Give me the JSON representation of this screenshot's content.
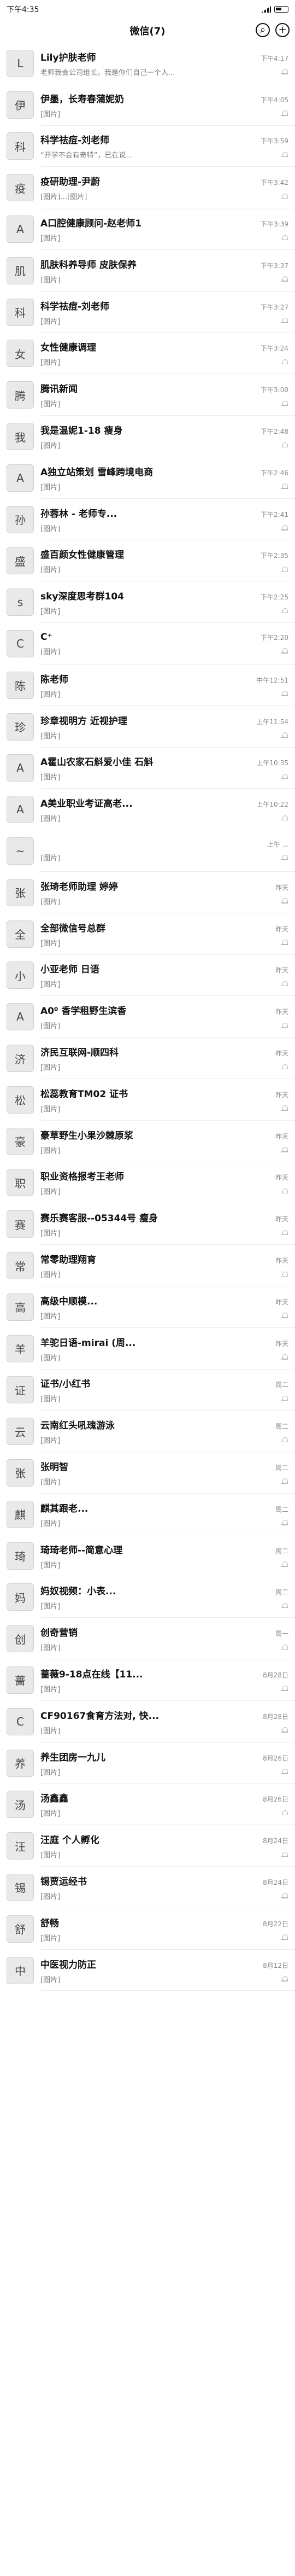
{
  "status": {
    "time": "下午4:35",
    "icon_name": "alarm-icon"
  },
  "header": {
    "title": "微信(7)"
  },
  "chats": [
    {
      "name": "Lily护肤老师",
      "time": "下午4:17",
      "preview": "老师我会公司组长，我是你们自己一个人...",
      "avatar": "L"
    },
    {
      "name": "伊墨，长寿春蒲妮奶",
      "time": "下午4:05",
      "preview": "[图片]",
      "avatar": "伊"
    },
    {
      "name": "科学祛痘-刘老师",
      "time": "下午3:59",
      "preview": "“开学不会有奇特”，已在说…",
      "avatar": "科"
    },
    {
      "name": "疫研助理-尹蔚",
      "time": "下午3:42",
      "preview": "[图片]…[图片]",
      "avatar": "疫"
    },
    {
      "name": "A口腔健康顾问-赵老师1",
      "time": "下午3:39",
      "preview": "[图片]",
      "avatar": "A"
    },
    {
      "name": "肌肤科养导师 皮肤保养",
      "time": "下午3:37",
      "preview": "[图片]",
      "avatar": "肌"
    },
    {
      "name": "科学祛痘-刘老师",
      "time": "下午3:27",
      "preview": "[图片]",
      "avatar": "科"
    },
    {
      "name": "女性健康调理",
      "time": "下午3:24",
      "preview": "[图片]",
      "avatar": "女"
    },
    {
      "name": "腾讯新闻",
      "time": "下午3:00",
      "preview": "[图片]",
      "avatar": "腾"
    },
    {
      "name": "我是温妮1-18 瘦身",
      "time": "下午2:48",
      "preview": "[图片]",
      "avatar": "我"
    },
    {
      "name": "A独立站策划 雪峰跨境电商",
      "time": "下午2:46",
      "preview": "[图片]",
      "avatar": "A"
    },
    {
      "name": "孙蓉林 - 老师专...",
      "time": "下午2:41",
      "preview": "[图片]",
      "avatar": "孙"
    },
    {
      "name": "盛百颜女性健康管理",
      "time": "下午2:35",
      "preview": "[图片]",
      "avatar": "盛"
    },
    {
      "name": "sky深度思考群104",
      "time": "下午2:25",
      "preview": "[图片]",
      "avatar": "s"
    },
    {
      "name": "C⁺",
      "time": "下午2:20",
      "preview": "[图片]",
      "avatar": "C"
    },
    {
      "name": "陈老师",
      "time": "中午12:51",
      "preview": "[图片]",
      "avatar": "陈"
    },
    {
      "name": "珍章视明方 近视护理",
      "time": "上午11:54",
      "preview": "[图片]",
      "avatar": "珍"
    },
    {
      "name": "A霍山农家石斛爱小佳 石斛",
      "time": "上午10:35",
      "preview": "[图片]",
      "avatar": "A"
    },
    {
      "name": "A美业职业考证高老...",
      "time": "上午10:22",
      "preview": "[图片]",
      "avatar": "A"
    },
    {
      "name": "",
      "time": "上午 ...",
      "preview": "[图片]",
      "avatar": "~"
    },
    {
      "name": "张琦老师助理 婷婷",
      "time": "昨天",
      "preview": "[图片]",
      "avatar": "张"
    },
    {
      "name": "全部微信号总群",
      "time": "昨天",
      "preview": "[图片]",
      "avatar": "全"
    },
    {
      "name": "小亚老师 日语",
      "time": "昨天",
      "preview": "[图片]",
      "avatar": "小"
    },
    {
      "name": "A0⁰ 香学租野生滨香",
      "time": "昨天",
      "preview": "[图片]",
      "avatar": "A"
    },
    {
      "name": "济民互联网-顺四科",
      "time": "昨天",
      "preview": "[图片]",
      "avatar": "济"
    },
    {
      "name": "松蕊教育TM02 证书",
      "time": "昨天",
      "preview": "[图片]",
      "avatar": "松"
    },
    {
      "name": "豪草野生小果沙棘原浆",
      "time": "昨天",
      "preview": "[图片]",
      "avatar": "豪"
    },
    {
      "name": "职业资格报考王老师",
      "time": "昨天",
      "preview": "[图片]",
      "avatar": "职"
    },
    {
      "name": "赛乐赛客服--05344号 瘦身",
      "time": "昨天",
      "preview": "[图片]",
      "avatar": "赛"
    },
    {
      "name": "常零助理翔育",
      "time": "昨天",
      "preview": "[图片]",
      "avatar": "常"
    },
    {
      "name": "高级中顺模...",
      "time": "昨天",
      "preview": "[图片]",
      "avatar": "高"
    },
    {
      "name": "羊驼日语-mirai (周...",
      "time": "昨天",
      "preview": "[图片]",
      "avatar": "羊"
    },
    {
      "name": "证书/小红书",
      "time": "周二",
      "preview": "[图片]",
      "avatar": "证"
    },
    {
      "name": "云南红头吼瑰游泳",
      "time": "周二",
      "preview": "[图片]",
      "avatar": "云"
    },
    {
      "name": "张明智",
      "time": "周二",
      "preview": "[图片]",
      "avatar": "张"
    },
    {
      "name": "麒其跟老...",
      "time": "周二",
      "preview": "[图片]",
      "avatar": "麒"
    },
    {
      "name": "琦琦老师--简意心理",
      "time": "周二",
      "preview": "[图片]",
      "avatar": "琦"
    },
    {
      "name": "妈奴视频：小表...",
      "time": "周二",
      "preview": "[图片]",
      "avatar": "妈"
    },
    {
      "name": "创奇营销",
      "time": "周一",
      "preview": "[图片]",
      "avatar": "创"
    },
    {
      "name": "蔷薇9-18点在线【11...",
      "time": "8月28日",
      "preview": "[图片]",
      "avatar": "蔷"
    },
    {
      "name": "CF90167食育方法对, 快...",
      "time": "8月28日",
      "preview": "[图片]",
      "avatar": "C"
    },
    {
      "name": "养生团房一九儿",
      "time": "8月26日",
      "preview": "[图片]",
      "avatar": "养"
    },
    {
      "name": "汤鑫鑫",
      "time": "8月26日",
      "preview": "[图片]",
      "avatar": "汤"
    },
    {
      "name": "汪庭 个人孵化",
      "time": "8月24日",
      "preview": "[图片]",
      "avatar": "汪"
    },
    {
      "name": "锡贾运经书",
      "time": "8月24日",
      "preview": "[图片]",
      "avatar": "锡"
    },
    {
      "name": "舒畅",
      "time": "8月22日",
      "preview": "[图片]",
      "avatar": "舒"
    },
    {
      "name": "中医视力防正",
      "time": "8月12日",
      "preview": "[图片]",
      "avatar": "中"
    }
  ]
}
